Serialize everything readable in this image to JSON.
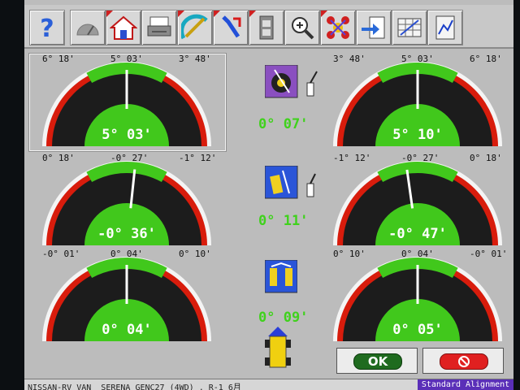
{
  "toolbar": {
    "buttons": [
      {
        "name": "help-icon"
      },
      {
        "name": "gauge-icon"
      },
      {
        "name": "home-icon"
      },
      {
        "name": "printer-icon"
      },
      {
        "name": "caliper-icon"
      },
      {
        "name": "wrench-arrow-icon"
      },
      {
        "name": "film-icon"
      },
      {
        "name": "magnifier-icon"
      },
      {
        "name": "wheel-network-icon"
      },
      {
        "name": "clipboard-arrow-icon"
      },
      {
        "name": "spreadsheet-icon"
      },
      {
        "name": "graph-network-icon"
      }
    ]
  },
  "gauges": {
    "front_left": {
      "left": "6° 18'",
      "mid": "5° 03'",
      "right": "3° 48'",
      "value": "5° 03'"
    },
    "front_right": {
      "left": "3° 48'",
      "mid": "5° 03'",
      "right": "6° 18'",
      "value": "5° 10'"
    },
    "camber_left": {
      "left": "0° 18'",
      "mid": "-0° 27'",
      "right": "-1° 12'",
      "value": "-0° 36'"
    },
    "camber_right": {
      "left": "-1° 12'",
      "mid": "-0° 27'",
      "right": "0° 18'",
      "value": "-0° 47'"
    },
    "toe_left": {
      "left": "-0° 01'",
      "mid": "0° 04'",
      "right": "0° 10'",
      "value": "0° 04'"
    },
    "toe_right": {
      "left": "0° 10'",
      "mid": "0° 04'",
      "right": "-0° 01'",
      "value": "0° 05'"
    }
  },
  "center": {
    "cross_caster": "0° 07'",
    "cross_camber": "0° 11'",
    "total_toe": "0° 09'"
  },
  "buttons": {
    "ok": "OK"
  },
  "status": {
    "vehicle": "NISSAN-RV VAN  SERENA GENC27 (4WD) , R-1 6月",
    "mode": "Standard Alignment"
  },
  "colors": {
    "green": "#41c81c",
    "red": "#d81c0c",
    "dark": "#1c1c1c"
  }
}
